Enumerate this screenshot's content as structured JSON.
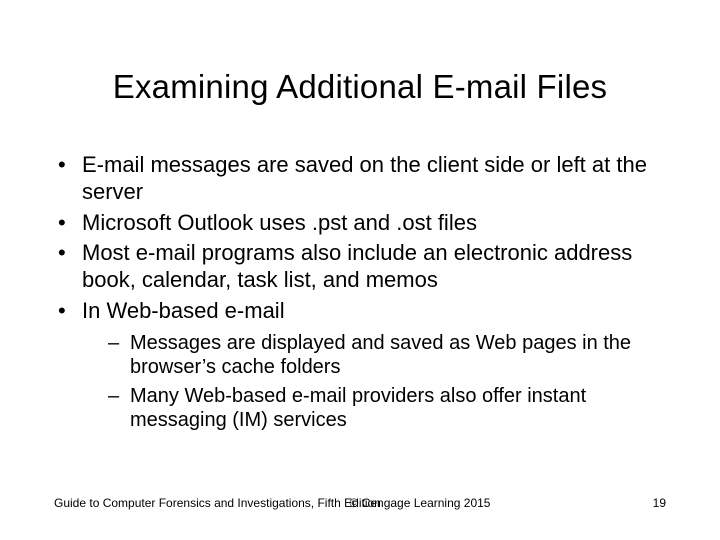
{
  "title": "Examining Additional E-mail Files",
  "bullets": [
    {
      "text": "E-mail messages are saved on the client side or left at the server"
    },
    {
      "text": "Microsoft Outlook uses .pst and .ost files"
    },
    {
      "text": "Most e-mail programs also include an electronic address book, calendar, task list, and memos"
    },
    {
      "text": "In Web-based e-mail",
      "sub": [
        "Messages are displayed and saved as Web pages in the browser’s cache folders",
        "Many Web-based e-mail providers also offer instant messaging (IM) services"
      ]
    }
  ],
  "footer": {
    "left": "Guide to Computer Forensics and Investigations, Fifth Edition",
    "center": "© Cengage Learning  2015",
    "right": "19"
  }
}
